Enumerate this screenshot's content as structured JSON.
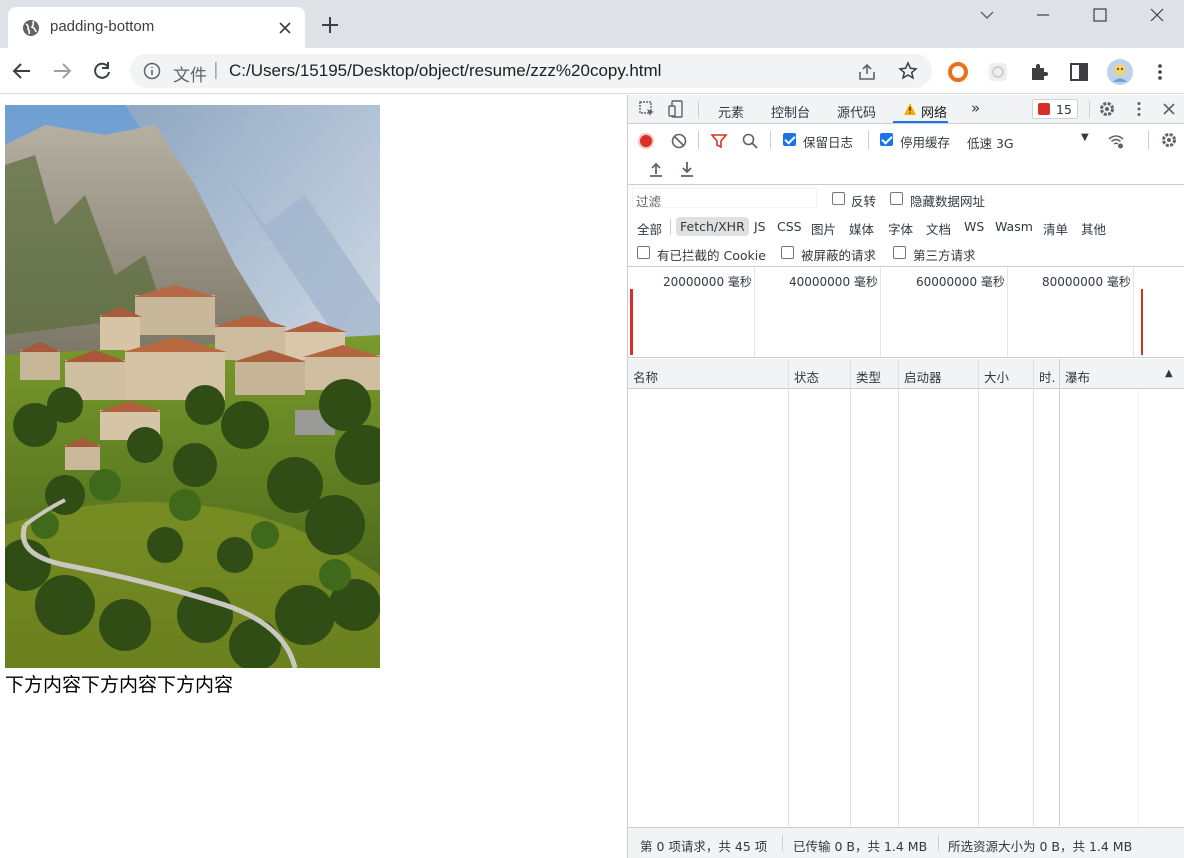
{
  "browser": {
    "tab_title": "padding-bottom",
    "scheme_label": "文件",
    "url": "C:/Users/15195/Desktop/object/resume/zzz%20copy.html"
  },
  "page": {
    "image_alt": "mountain village photo",
    "below_text": "下方内容下方内容下方内容"
  },
  "devtools": {
    "tabs": [
      "元素",
      "控制台",
      "源代码",
      "网络"
    ],
    "active_tab": "网络",
    "error_count": "15",
    "toolbar": {
      "preserve_log": "保留日志",
      "disable_cache": "停用缓存",
      "throttling": "低速 3G"
    },
    "filter": {
      "placeholder": "过滤",
      "invert": "反转",
      "hide_data_urls": "隐藏数据网址"
    },
    "types": [
      "全部",
      "Fetch/XHR",
      "JS",
      "CSS",
      "图片",
      "媒体",
      "字体",
      "文档",
      "WS",
      "Wasm",
      "清单",
      "其他"
    ],
    "active_type": "Fetch/XHR",
    "options": {
      "blocked_cookies": "有已拦截的 Cookie",
      "blocked_requests": "被屏蔽的请求",
      "third_party": "第三方请求"
    },
    "overview_ticks": [
      "20000000 毫秒",
      "40000000 毫秒",
      "60000000 毫秒",
      "80000000 毫秒"
    ],
    "columns": [
      "名称",
      "状态",
      "类型",
      "启动器",
      "大小",
      "时.",
      "瀑布"
    ],
    "status": {
      "requests": "第 0 项请求，共 45 项",
      "transferred": "已传输 0 B，共 1.4 MB",
      "resources": "所选资源大小为 0 B，共 1.4 MB"
    }
  },
  "colors": {
    "accent": "#1a73e8",
    "record": "#d93025",
    "chrome_bg": "#dee1e6"
  }
}
